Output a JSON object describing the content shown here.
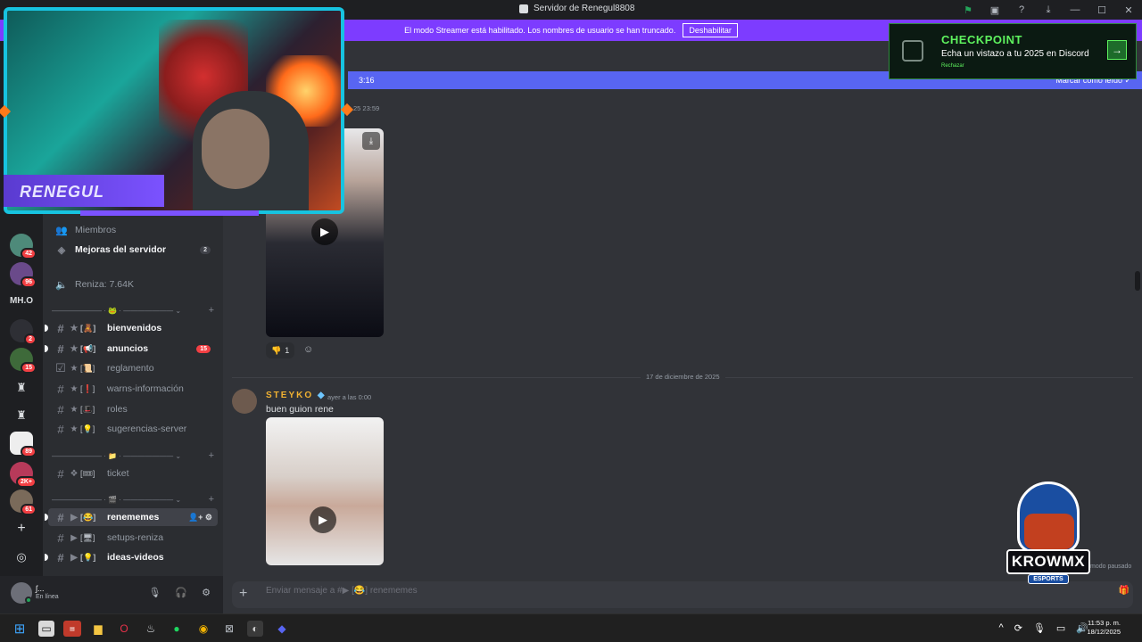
{
  "window": {
    "title": "Servidor de Renegul8808",
    "controls": [
      "minimize",
      "maximize",
      "close"
    ]
  },
  "streamer_banner": {
    "text": "El modo Streamer está habilitado. Los nombres de usuario se han truncado.",
    "button": "Deshabilitar"
  },
  "webcam": {
    "name": "RENEGUL"
  },
  "servers": [
    {
      "badge": "42"
    },
    {
      "badge": "96"
    },
    {
      "label": "MH.O"
    },
    {
      "badge": "2"
    },
    {
      "badge": "15"
    },
    {
      "badge": ""
    },
    {
      "badge": ""
    },
    {
      "badge": "89"
    },
    {
      "badge": "2K+"
    },
    {
      "badge": "61"
    }
  ],
  "sidebar": {
    "members": "Miembros",
    "boosts": {
      "label": "Mejoras del servidor",
      "count": "2"
    },
    "voice_renta": "Reniza: 7.64K",
    "categories": [
      "——————— · 🐸 · ——————— ⌄",
      "——————— · 📁 · ——————— ⌄",
      "——————— · 🎬 · ——————— ⌄"
    ],
    "channels": [
      {
        "emoji": "[🧸]",
        "name": "bienvenidos",
        "count": ""
      },
      {
        "emoji": "[📢]",
        "name": "anuncios",
        "count": "15"
      },
      {
        "emoji": "[📜]",
        "name": "reglamento",
        "count": ""
      },
      {
        "emoji": "[❗]",
        "name": "warns-información",
        "count": ""
      },
      {
        "emoji": "[🎩]",
        "name": "roles",
        "count": ""
      },
      {
        "emoji": "[💡]",
        "name": "sugerencias-server",
        "count": ""
      },
      {
        "emoji": "[🎟]",
        "name": "ticket",
        "count": ""
      },
      {
        "emoji": "[😂]",
        "name": "renememes",
        "count": ""
      },
      {
        "emoji": "[🖥]",
        "name": "setups-reniza",
        "count": ""
      },
      {
        "emoji": "[💡]",
        "name": "ideas-videos",
        "count": ""
      }
    ]
  },
  "user": {
    "name": "ʃ...",
    "status": "En línea"
  },
  "chat": {
    "new_messages_time": "3:16",
    "mark_read": "Marcar como leído",
    "first_timestamp": "25 23:59",
    "reaction_count": "1",
    "date_divider": "17 de diciembre de 2025",
    "message": {
      "author": "STEYKO",
      "timestamp": "ayer a las 0:00",
      "text": "buen guion rene"
    },
    "composer_placeholder": "Enviar mensaje a #▶ [😂] renememes"
  },
  "checkpoint": {
    "title": "CHECKPOINT",
    "subtitle": "Echa un vistazo a tu 2025 en Discord",
    "dismiss": "Rechazar"
  },
  "logo": {
    "name": "KROWMX",
    "sub": "ESPORTS"
  },
  "paused": "modo pausado",
  "clock": {
    "time": "11:53 p. m.",
    "date": "18/12/2025"
  },
  "colors": {
    "blurple": "#5865f2",
    "streamer_purple": "#7d3cff",
    "checkpoint_green": "#5ef25e"
  }
}
